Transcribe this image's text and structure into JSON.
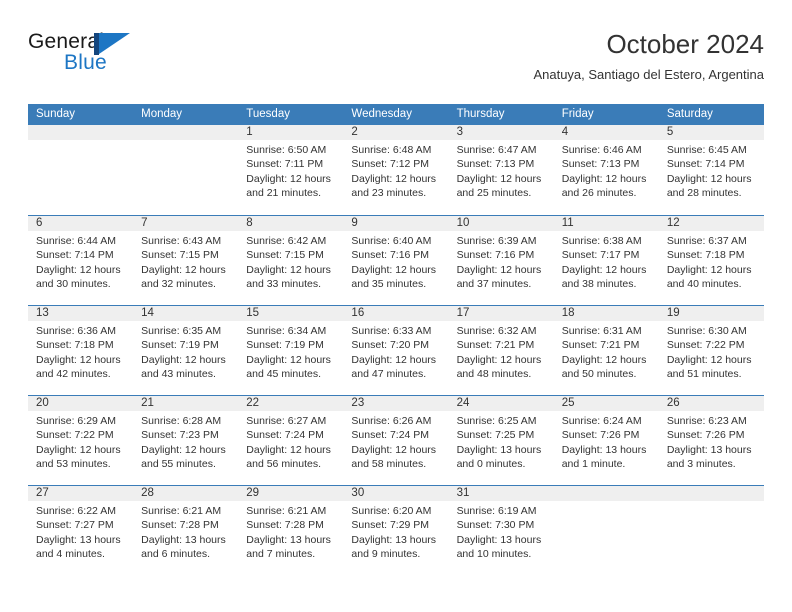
{
  "brand": {
    "name_top": "General",
    "name_bottom": "Blue",
    "logo_icon": "flag-triangle-icon",
    "dark_blue": "#14467e",
    "light_blue": "#1d76c4"
  },
  "header": {
    "title": "October 2024",
    "subtitle": "Anatuya, Santiago del Estero, Argentina"
  },
  "theme": {
    "header_blue": "#3a7cb8",
    "band_gray": "#efefef",
    "text": "#333333"
  },
  "weekdays": [
    "Sunday",
    "Monday",
    "Tuesday",
    "Wednesday",
    "Thursday",
    "Friday",
    "Saturday"
  ],
  "weeks": [
    [
      {
        "day": "",
        "lines": []
      },
      {
        "day": "",
        "lines": []
      },
      {
        "day": "1",
        "lines": [
          "Sunrise: 6:50 AM",
          "Sunset: 7:11 PM",
          "Daylight: 12 hours",
          "and 21 minutes."
        ]
      },
      {
        "day": "2",
        "lines": [
          "Sunrise: 6:48 AM",
          "Sunset: 7:12 PM",
          "Daylight: 12 hours",
          "and 23 minutes."
        ]
      },
      {
        "day": "3",
        "lines": [
          "Sunrise: 6:47 AM",
          "Sunset: 7:13 PM",
          "Daylight: 12 hours",
          "and 25 minutes."
        ]
      },
      {
        "day": "4",
        "lines": [
          "Sunrise: 6:46 AM",
          "Sunset: 7:13 PM",
          "Daylight: 12 hours",
          "and 26 minutes."
        ]
      },
      {
        "day": "5",
        "lines": [
          "Sunrise: 6:45 AM",
          "Sunset: 7:14 PM",
          "Daylight: 12 hours",
          "and 28 minutes."
        ]
      }
    ],
    [
      {
        "day": "6",
        "lines": [
          "Sunrise: 6:44 AM",
          "Sunset: 7:14 PM",
          "Daylight: 12 hours",
          "and 30 minutes."
        ]
      },
      {
        "day": "7",
        "lines": [
          "Sunrise: 6:43 AM",
          "Sunset: 7:15 PM",
          "Daylight: 12 hours",
          "and 32 minutes."
        ]
      },
      {
        "day": "8",
        "lines": [
          "Sunrise: 6:42 AM",
          "Sunset: 7:15 PM",
          "Daylight: 12 hours",
          "and 33 minutes."
        ]
      },
      {
        "day": "9",
        "lines": [
          "Sunrise: 6:40 AM",
          "Sunset: 7:16 PM",
          "Daylight: 12 hours",
          "and 35 minutes."
        ]
      },
      {
        "day": "10",
        "lines": [
          "Sunrise: 6:39 AM",
          "Sunset: 7:16 PM",
          "Daylight: 12 hours",
          "and 37 minutes."
        ]
      },
      {
        "day": "11",
        "lines": [
          "Sunrise: 6:38 AM",
          "Sunset: 7:17 PM",
          "Daylight: 12 hours",
          "and 38 minutes."
        ]
      },
      {
        "day": "12",
        "lines": [
          "Sunrise: 6:37 AM",
          "Sunset: 7:18 PM",
          "Daylight: 12 hours",
          "and 40 minutes."
        ]
      }
    ],
    [
      {
        "day": "13",
        "lines": [
          "Sunrise: 6:36 AM",
          "Sunset: 7:18 PM",
          "Daylight: 12 hours",
          "and 42 minutes."
        ]
      },
      {
        "day": "14",
        "lines": [
          "Sunrise: 6:35 AM",
          "Sunset: 7:19 PM",
          "Daylight: 12 hours",
          "and 43 minutes."
        ]
      },
      {
        "day": "15",
        "lines": [
          "Sunrise: 6:34 AM",
          "Sunset: 7:19 PM",
          "Daylight: 12 hours",
          "and 45 minutes."
        ]
      },
      {
        "day": "16",
        "lines": [
          "Sunrise: 6:33 AM",
          "Sunset: 7:20 PM",
          "Daylight: 12 hours",
          "and 47 minutes."
        ]
      },
      {
        "day": "17",
        "lines": [
          "Sunrise: 6:32 AM",
          "Sunset: 7:21 PM",
          "Daylight: 12 hours",
          "and 48 minutes."
        ]
      },
      {
        "day": "18",
        "lines": [
          "Sunrise: 6:31 AM",
          "Sunset: 7:21 PM",
          "Daylight: 12 hours",
          "and 50 minutes."
        ]
      },
      {
        "day": "19",
        "lines": [
          "Sunrise: 6:30 AM",
          "Sunset: 7:22 PM",
          "Daylight: 12 hours",
          "and 51 minutes."
        ]
      }
    ],
    [
      {
        "day": "20",
        "lines": [
          "Sunrise: 6:29 AM",
          "Sunset: 7:22 PM",
          "Daylight: 12 hours",
          "and 53 minutes."
        ]
      },
      {
        "day": "21",
        "lines": [
          "Sunrise: 6:28 AM",
          "Sunset: 7:23 PM",
          "Daylight: 12 hours",
          "and 55 minutes."
        ]
      },
      {
        "day": "22",
        "lines": [
          "Sunrise: 6:27 AM",
          "Sunset: 7:24 PM",
          "Daylight: 12 hours",
          "and 56 minutes."
        ]
      },
      {
        "day": "23",
        "lines": [
          "Sunrise: 6:26 AM",
          "Sunset: 7:24 PM",
          "Daylight: 12 hours",
          "and 58 minutes."
        ]
      },
      {
        "day": "24",
        "lines": [
          "Sunrise: 6:25 AM",
          "Sunset: 7:25 PM",
          "Daylight: 13 hours",
          "and 0 minutes."
        ]
      },
      {
        "day": "25",
        "lines": [
          "Sunrise: 6:24 AM",
          "Sunset: 7:26 PM",
          "Daylight: 13 hours",
          "and 1 minute."
        ]
      },
      {
        "day": "26",
        "lines": [
          "Sunrise: 6:23 AM",
          "Sunset: 7:26 PM",
          "Daylight: 13 hours",
          "and 3 minutes."
        ]
      }
    ],
    [
      {
        "day": "27",
        "lines": [
          "Sunrise: 6:22 AM",
          "Sunset: 7:27 PM",
          "Daylight: 13 hours",
          "and 4 minutes."
        ]
      },
      {
        "day": "28",
        "lines": [
          "Sunrise: 6:21 AM",
          "Sunset: 7:28 PM",
          "Daylight: 13 hours",
          "and 6 minutes."
        ]
      },
      {
        "day": "29",
        "lines": [
          "Sunrise: 6:21 AM",
          "Sunset: 7:28 PM",
          "Daylight: 13 hours",
          "and 7 minutes."
        ]
      },
      {
        "day": "30",
        "lines": [
          "Sunrise: 6:20 AM",
          "Sunset: 7:29 PM",
          "Daylight: 13 hours",
          "and 9 minutes."
        ]
      },
      {
        "day": "31",
        "lines": [
          "Sunrise: 6:19 AM",
          "Sunset: 7:30 PM",
          "Daylight: 13 hours",
          "and 10 minutes."
        ]
      },
      {
        "day": "",
        "lines": []
      },
      {
        "day": "",
        "lines": []
      }
    ]
  ]
}
